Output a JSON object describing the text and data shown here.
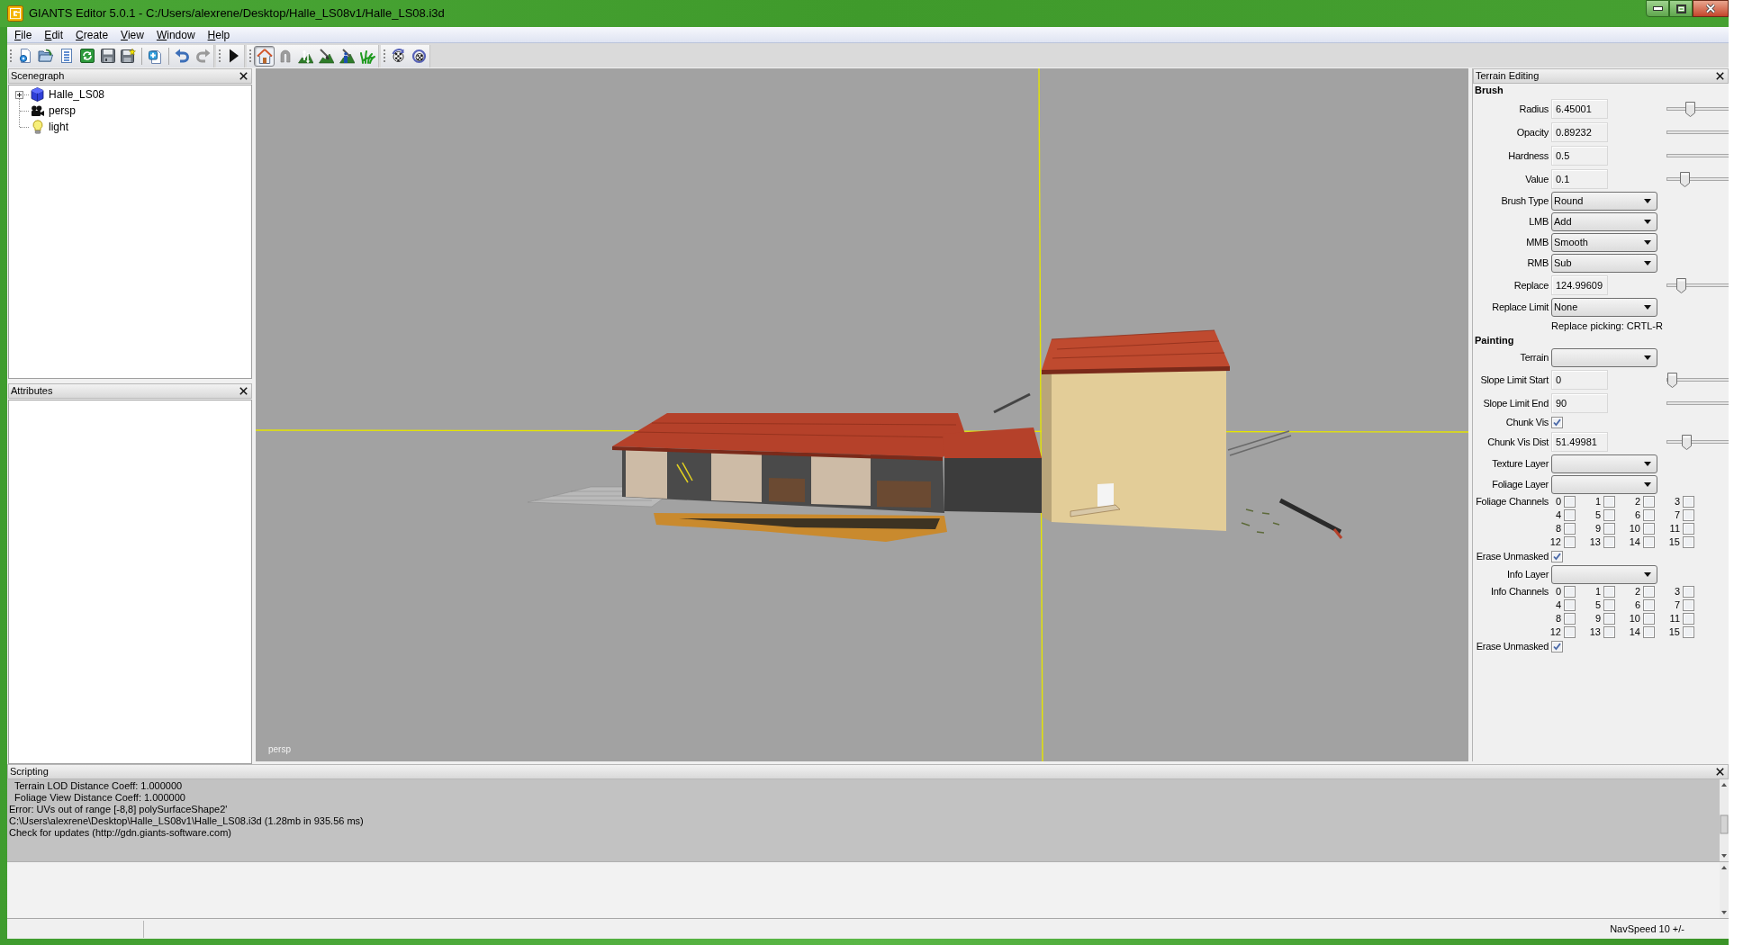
{
  "window": {
    "title": "GIANTS Editor 5.0.1 - C:/Users/alexrene/Desktop/Halle_LS08v1/Halle_LS08.i3d"
  },
  "menu": [
    "File",
    "Edit",
    "Create",
    "View",
    "Window",
    "Help"
  ],
  "toolbar": {
    "history": [
      {
        "disabled": false
      },
      {
        "disabled": true
      }
    ],
    "tools": [
      {
        "selected": true,
        "disabled": false
      },
      {
        "selected": false,
        "disabled": true
      },
      {
        "selected": false,
        "disabled": false
      },
      {
        "selected": false,
        "disabled": false
      },
      {
        "selected": false,
        "disabled": false
      },
      {
        "selected": false,
        "disabled": false
      }
    ]
  },
  "scenegraph": {
    "title": "Scenegraph",
    "tree": [
      {
        "label": "Halle_LS08",
        "kind": "transform",
        "expanded": false
      },
      {
        "label": "persp",
        "kind": "camera"
      },
      {
        "label": "light",
        "kind": "light"
      }
    ]
  },
  "attributes": {
    "title": "Attributes"
  },
  "viewport": {
    "camera_label": "persp"
  },
  "terrain_editing": {
    "title": "Terrain Editing",
    "sections": [
      {
        "heading": "Brush",
        "rows": [
          {
            "kind": "number",
            "label": "Radius",
            "value": "6.45001",
            "level": 0.34
          },
          {
            "kind": "number",
            "label": "Opacity",
            "value": "0.89232"
          },
          {
            "kind": "number",
            "label": "Hardness",
            "value": "0.5"
          },
          {
            "kind": "number",
            "label": "Value",
            "value": "0.1",
            "level": 0.24
          },
          {
            "kind": "select",
            "label": "Brush Type",
            "value": "Round"
          },
          {
            "kind": "select",
            "label": "LMB",
            "value": "Add"
          },
          {
            "kind": "select",
            "label": "MMB",
            "value": "Smooth"
          },
          {
            "kind": "select",
            "label": "RMB",
            "value": "Sub"
          },
          {
            "kind": "number",
            "label": "Replace",
            "value": "124.99609",
            "level": 0.17
          },
          {
            "kind": "select",
            "label": "Replace Limit",
            "value": "None"
          },
          {
            "kind": "note",
            "text": "Replace picking: CRTL-R"
          }
        ]
      },
      {
        "heading": "Painting",
        "rows": [
          {
            "kind": "select",
            "label": "Terrain"
          },
          {
            "kind": "number",
            "label": "Slope Limit Start",
            "value": "0",
            "level": 0
          },
          {
            "kind": "number",
            "label": "Slope Limit End",
            "value": "90"
          },
          {
            "kind": "checkbox",
            "label": "Chunk Vis",
            "checked": true
          },
          {
            "kind": "number",
            "label": "Chunk Vis Dist",
            "value": "51.49981",
            "level": 0.27
          },
          {
            "kind": "select",
            "label": "Texture Layer"
          },
          {
            "kind": "select",
            "label": "Foliage Layer"
          },
          {
            "kind": "channels",
            "label": "Foliage Channels",
            "channels": [
              {
                "label": "0",
                "checked": false
              },
              {
                "label": "1",
                "checked": false
              },
              {
                "label": "2",
                "checked": false
              },
              {
                "label": "3",
                "checked": false
              },
              {
                "label": "4",
                "checked": false
              },
              {
                "label": "5",
                "checked": false
              },
              {
                "label": "6",
                "checked": false
              },
              {
                "label": "7",
                "checked": false
              },
              {
                "label": "8",
                "checked": false
              },
              {
                "label": "9",
                "checked": false
              },
              {
                "label": "10",
                "checked": false
              },
              {
                "label": "11",
                "checked": false
              },
              {
                "label": "12",
                "checked": false
              },
              {
                "label": "13",
                "checked": false
              },
              {
                "label": "14",
                "checked": false
              },
              {
                "label": "15",
                "checked": false
              }
            ]
          },
          {
            "kind": "checkbox",
            "label": "Erase Unmasked",
            "checked": true
          },
          {
            "kind": "select",
            "label": "Info Layer"
          },
          {
            "kind": "channels",
            "label": "Info Channels",
            "channels": [
              {
                "label": "0",
                "checked": false
              },
              {
                "label": "1",
                "checked": false
              },
              {
                "label": "2",
                "checked": false
              },
              {
                "label": "3",
                "checked": false
              },
              {
                "label": "4",
                "checked": false
              },
              {
                "label": "5",
                "checked": false
              },
              {
                "label": "6",
                "checked": false
              },
              {
                "label": "7",
                "checked": false
              },
              {
                "label": "8",
                "checked": false
              },
              {
                "label": "9",
                "checked": false
              },
              {
                "label": "10",
                "checked": false
              },
              {
                "label": "11",
                "checked": false
              },
              {
                "label": "12",
                "checked": false
              },
              {
                "label": "13",
                "checked": false
              },
              {
                "label": "14",
                "checked": false
              },
              {
                "label": "15",
                "checked": false
              }
            ]
          },
          {
            "kind": "checkbox",
            "label": "Erase Unmasked",
            "checked": true
          }
        ]
      }
    ]
  },
  "scripting": {
    "title": "Scripting",
    "lines": [
      "  Terrain LOD Distance Coeff: 1.000000",
      "  Foliage View Distance Coeff: 1.000000",
      "Error: UVs out of range [-8,8] polySurfaceShape2'",
      "C:\\Users\\alexrene\\Desktop\\Halle_LS08v1\\Halle_LS08.i3d (1.28mb in 935.56 ms)",
      "Check for updates (http://gdn.giants-software.com)"
    ]
  },
  "status_bar": {
    "text": "NavSpeed 10 +/-"
  }
}
